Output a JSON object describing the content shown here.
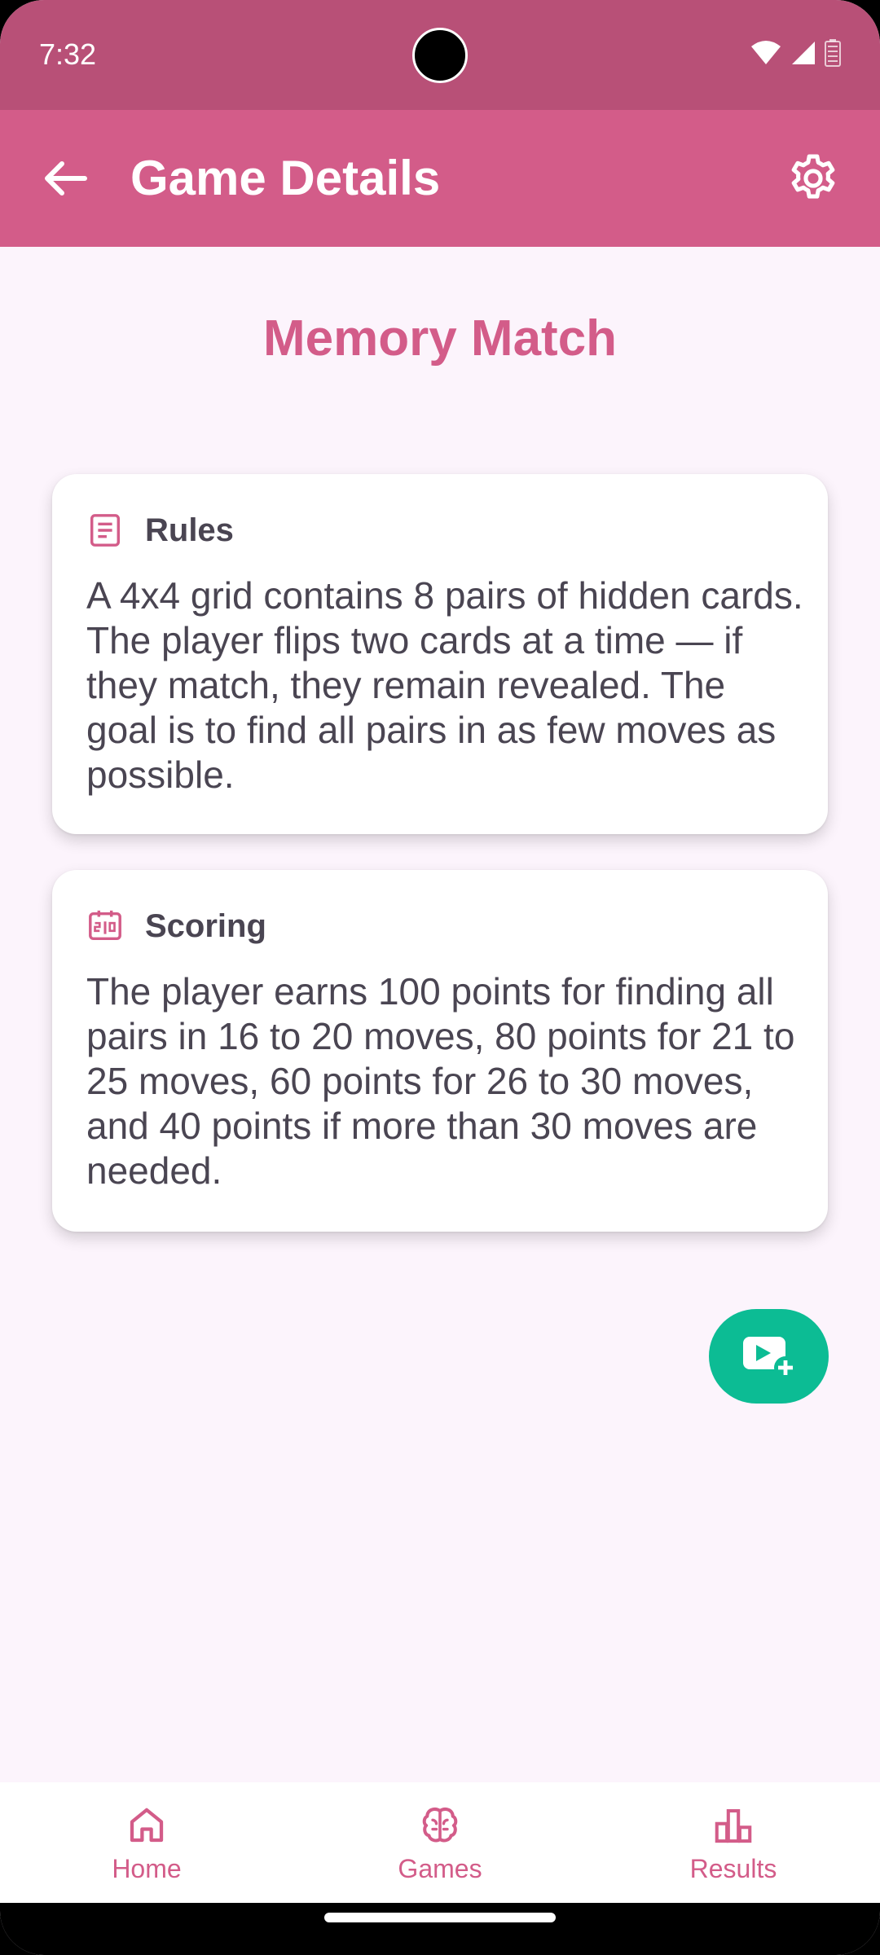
{
  "status_bar": {
    "time": "7:32"
  },
  "app_bar": {
    "title": "Game Details",
    "back_icon": "arrow-back-icon",
    "settings_icon": "gear-icon"
  },
  "game": {
    "title": "Memory Match"
  },
  "cards": {
    "rules": {
      "icon": "document-icon",
      "title": "Rules",
      "body": "A 4x4 grid contains 8 pairs of hidden cards. The player flips two cards at a time — if they match, they remain revealed. The goal is to find all pairs in as few moves as possible."
    },
    "scoring": {
      "icon": "scoreboard-icon",
      "title": "Scoring",
      "body": "The player earns 100 points for finding all pairs in 16 to 20 moves, 80 points for 21 to 25 moves, 60 points for 26 to 30 moves, and 40 points if more than 30 moves are needed."
    }
  },
  "fab": {
    "icon": "video-add-icon"
  },
  "bottom_nav": {
    "items": [
      {
        "label": "Home",
        "icon": "home-icon"
      },
      {
        "label": "Games",
        "icon": "brain-icon"
      },
      {
        "label": "Results",
        "icon": "bar-chart-icon"
      }
    ]
  },
  "colors": {
    "status_bar": "#b85077",
    "app_bar": "#d35c89",
    "accent": "#d35c89",
    "fab": "#0cbc94",
    "background": "#fcf4fc",
    "text": "#4a4552"
  }
}
